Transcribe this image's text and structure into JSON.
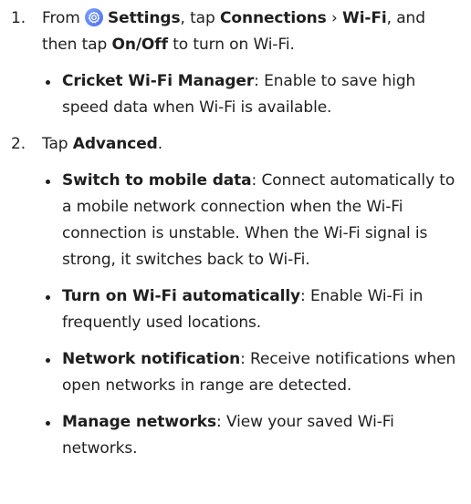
{
  "step1": {
    "number": "1.",
    "from": "From",
    "settings": "Settings",
    "tap_a": ", tap",
    "connections": "Connections",
    "chevron": "›",
    "wifi": "Wi-Fi",
    "and_then_tap": ", and then tap",
    "onoff": "On/Off",
    "to_turn_on": "to turn on Wi-Fi."
  },
  "bullet1": {
    "term": "Cricket Wi-Fi Manager",
    "desc": ": Enable to save high speed data when Wi-Fi is available."
  },
  "step2": {
    "number": "2.",
    "tap": "Tap",
    "advanced": "Advanced",
    "period": "."
  },
  "bullets2": [
    {
      "term": "Switch to mobile data",
      "desc": ": Connect automatically to a mobile network connection when the Wi-Fi connection is unstable. When the Wi-Fi signal is strong, it switches back to Wi-Fi."
    },
    {
      "term": "Turn on Wi-Fi automatically",
      "desc": ": Enable Wi-Fi in frequently used locations."
    },
    {
      "term": "Network notification",
      "desc": ": Receive notifications when open networks in range are detected."
    },
    {
      "term": "Manage networks",
      "desc": ": View your saved Wi-Fi networks."
    }
  ],
  "icons": {
    "settings": "settings-gear-icon",
    "accent": "#5b7ff6"
  }
}
